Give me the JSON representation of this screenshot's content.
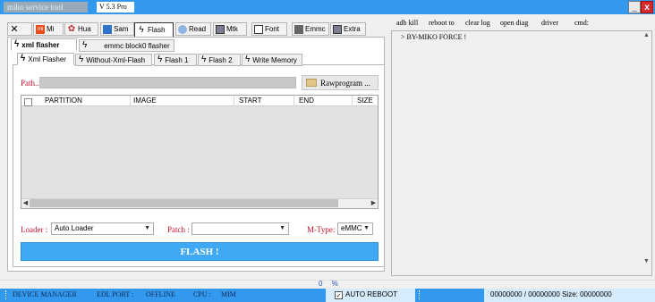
{
  "window": {
    "title": "miko service tool",
    "version": "V 5.3 Pro",
    "minimize_label": "_",
    "close_label": "x"
  },
  "brand_tabs": [
    {
      "label": "",
      "icon": "tools-icon"
    },
    {
      "label": "Mi",
      "icon": "xiaomi-icon"
    },
    {
      "label": "Hua",
      "icon": "huawei-icon"
    },
    {
      "label": "Sam",
      "icon": "samsung-icon"
    },
    {
      "label": "Flash",
      "icon": "bolt-icon",
      "active": true
    },
    {
      "label": "Read",
      "icon": "read-icon"
    },
    {
      "label": "Mtk",
      "icon": "chip-icon"
    },
    {
      "label": "Font",
      "icon": "document-icon"
    },
    {
      "label": "Emmc",
      "icon": "emmc-icon"
    },
    {
      "label": "Extra",
      "icon": "extra-icon"
    }
  ],
  "flash_tabs": [
    {
      "label": "xml flasher",
      "active": true
    },
    {
      "label": "emmc block0 flasher"
    }
  ],
  "xml_tabs": [
    {
      "label": "Xml Flasher",
      "active": true
    },
    {
      "label": "Without-Xml-Flash"
    },
    {
      "label": "Flash 1"
    },
    {
      "label": "Flash 2"
    },
    {
      "label": "Write Memory"
    }
  ],
  "path": {
    "label": "Path..",
    "value": "",
    "button_label": "Rawprogram ..."
  },
  "table": {
    "columns": [
      "PARTITION",
      "IMAGE",
      "START",
      "END",
      "SIZE"
    ],
    "rows": []
  },
  "options": {
    "loader_label": "Loader :",
    "loader_value": "Auto Loader",
    "patch_label": "Patch :",
    "patch_value": "",
    "mtype_label": "M-Type:",
    "mtype_value": "eMMC"
  },
  "flash_button": "FLASH !",
  "commands": [
    "adb kill",
    "reboot to",
    "clear log",
    "open diag",
    "driver",
    "cmd:"
  ],
  "log": [
    "> BY-MIKO FORCE !"
  ],
  "progress": {
    "value": "0",
    "unit": "%"
  },
  "status": {
    "device_manager": "DEVICE MANAGER",
    "edl_port_label": "EDL PORT :",
    "edl_port_value": "OFFLINE",
    "cpu_label": "CPU :",
    "cpu_value": "MIM",
    "auto_reboot_label": "AUTO REBOOT",
    "auto_reboot_checked": true,
    "counter": "00000000 / 00000000",
    "size_label": "Size: 00000000"
  },
  "colors": {
    "accent": "#3399ee",
    "flash_button": "#3fa9f5",
    "label_red": "#c8102e",
    "close": "#d82a2a"
  }
}
